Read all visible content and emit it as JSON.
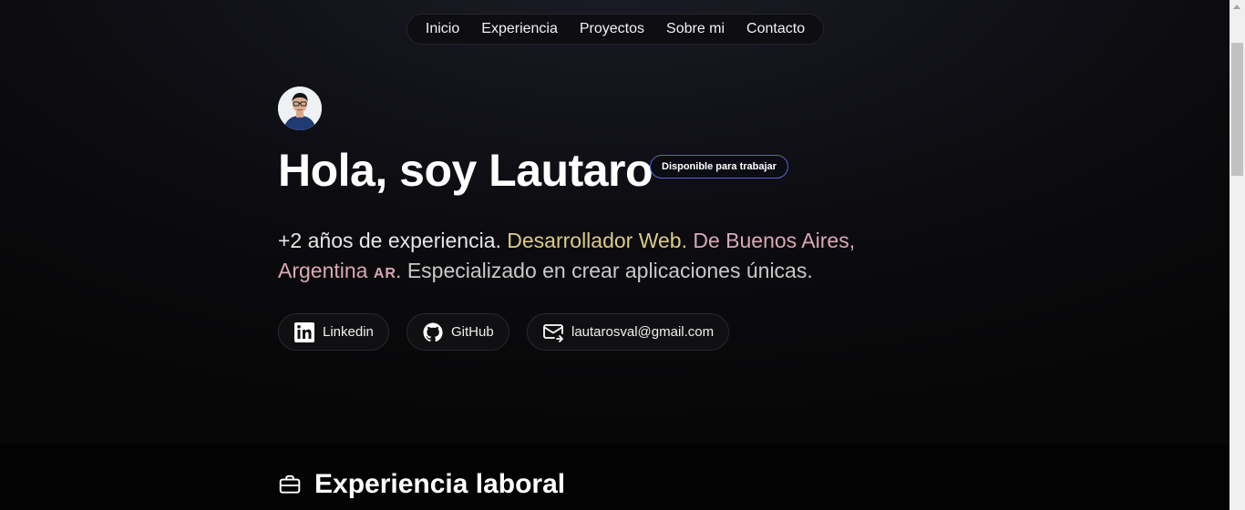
{
  "nav": {
    "items": [
      {
        "label": "Inicio"
      },
      {
        "label": "Experiencia"
      },
      {
        "label": "Proyectos"
      },
      {
        "label": "Sobre mi"
      },
      {
        "label": "Contacto"
      }
    ]
  },
  "hero": {
    "avatar_icon": "avatar-photo",
    "title": "Hola, soy Lautaro",
    "badge": "Disponible para trabajar",
    "intro_part1": "+2 años de experiencia. ",
    "intro_highlight_role": "Desarrollador Web.",
    "intro_highlight_location": "De Buenos Aires, Argentina",
    "intro_country_code": "AR.",
    "intro_part2": "Especializado en crear aplicaciones únicas."
  },
  "contact": {
    "linkedin_label": "Linkedin",
    "github_label": "GitHub",
    "email_label": "lautarosval@gmail.com"
  },
  "section": {
    "title": "Experiencia laboral",
    "icon": "briefcase-icon"
  },
  "colors": {
    "badge_border": "#5d5fd8",
    "highlight_yellow": "#dccb86",
    "highlight_pink": "#d9a8b4"
  }
}
